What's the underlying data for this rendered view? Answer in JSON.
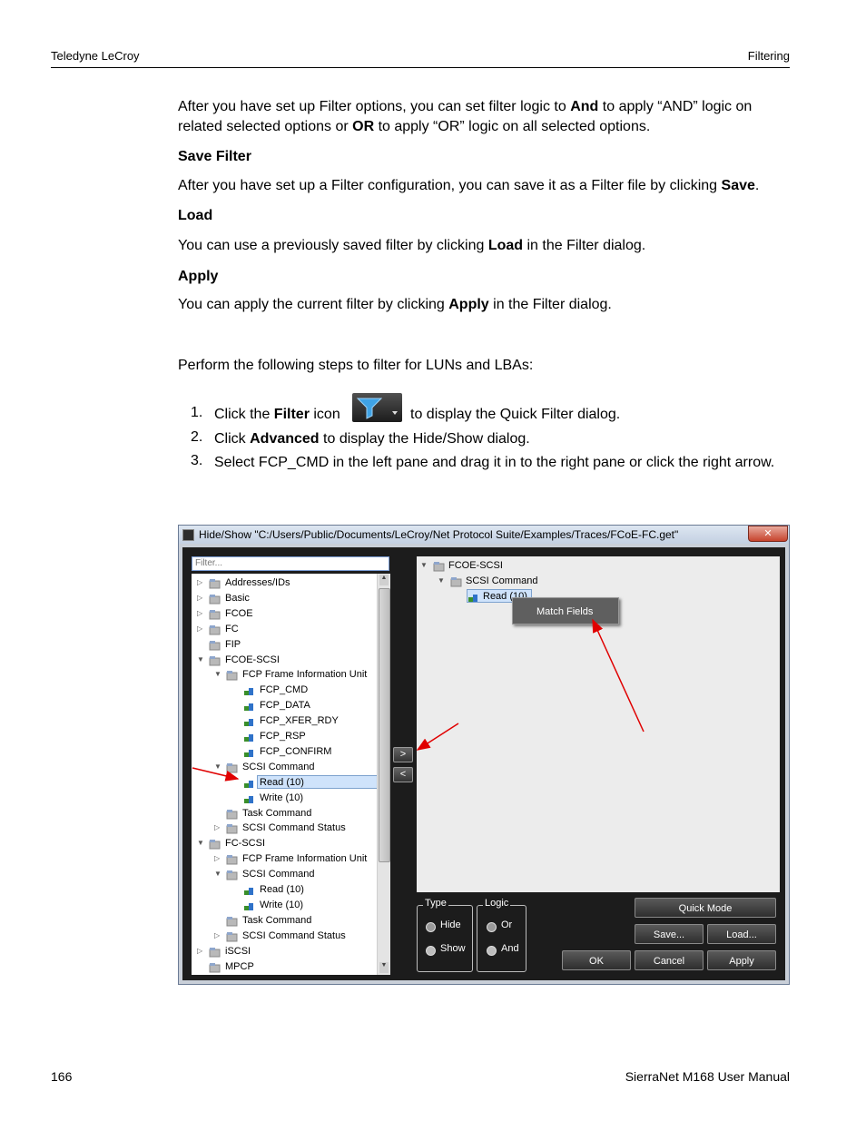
{
  "header": {
    "left": "Teledyne LeCroy",
    "right": "Filtering"
  },
  "footer": {
    "page_number": "166",
    "manual": "SierraNet M168 User Manual"
  },
  "para1": {
    "t1": "After you have set up Filter options, you can set filter logic to ",
    "b1": "And",
    "t2": " to apply “AND” logic on related selected options or ",
    "b2": "OR",
    "t3": " to apply “OR” logic on all selected options."
  },
  "save_filter": {
    "heading": "Save Filter",
    "t1": "After you have set up a Filter configuration, you can save it as a Filter file by clicking ",
    "b1": "Save",
    "t2": "."
  },
  "load": {
    "heading": "Load",
    "t1": "You can use a previously saved filter by clicking ",
    "b1": "Load",
    "t2": " in the Filter dialog."
  },
  "apply": {
    "heading": "Apply",
    "t1": "You can apply the current filter by clicking ",
    "b1": "Apply",
    "t2": " in the Filter dialog."
  },
  "intro": "Perform the following steps to filter for LUNs and LBAs:",
  "steps": [
    {
      "num": "1.",
      "t1": "Click the ",
      "b1": "Filter",
      "t2": " icon",
      "t3": " to display the Quick Filter dialog."
    },
    {
      "num": "2.",
      "t1": "Click ",
      "b1": "Advanced",
      "t2": " to display the Hide/Show dialog."
    },
    {
      "num": "3.",
      "t1": "Select FCP_CMD in the left pane and drag it in to the right pane or click the right arrow."
    }
  ],
  "dialog": {
    "title": "Hide/Show \"C:/Users/Public/Documents/LeCroy/Net Protocol Suite/Examples/Traces/FCoE-FC.get\"",
    "filter_placeholder": "Filter...",
    "tree": [
      "Addresses/IDs",
      "Basic",
      "FCOE",
      "FC",
      "FIP",
      "FCOE-SCSI",
      "FCP Frame Information Unit",
      "FCP_CMD",
      "FCP_DATA",
      "FCP_XFER_RDY",
      "FCP_RSP",
      "FCP_CONFIRM",
      "SCSI Command",
      "Read (10)",
      "Write (10)",
      "Task Command",
      "SCSI Command Status",
      "FC-SCSI",
      "FCP Frame Information Unit",
      "SCSI Command",
      "Read (10)",
      "Write (10)",
      "Task Command",
      "SCSI Command Status",
      "iSCSI",
      "MPCP"
    ],
    "right_tree": [
      "FCOE-SCSI",
      "SCSI Command",
      "Read (10)"
    ],
    "context_menu": "Match Fields",
    "type_group": {
      "label": "Type",
      "options": [
        "Hide",
        "Show"
      ]
    },
    "logic_group": {
      "label": "Logic",
      "options": [
        "Or",
        "And"
      ]
    },
    "buttons": {
      "quick_mode": "Quick Mode",
      "save": "Save...",
      "load": "Load...",
      "ok": "OK",
      "cancel": "Cancel",
      "apply": "Apply"
    }
  },
  "colors": {
    "arrow": "#e00000",
    "selection": "#cfe3fb",
    "dialog_bg": "#1c1c1c"
  }
}
